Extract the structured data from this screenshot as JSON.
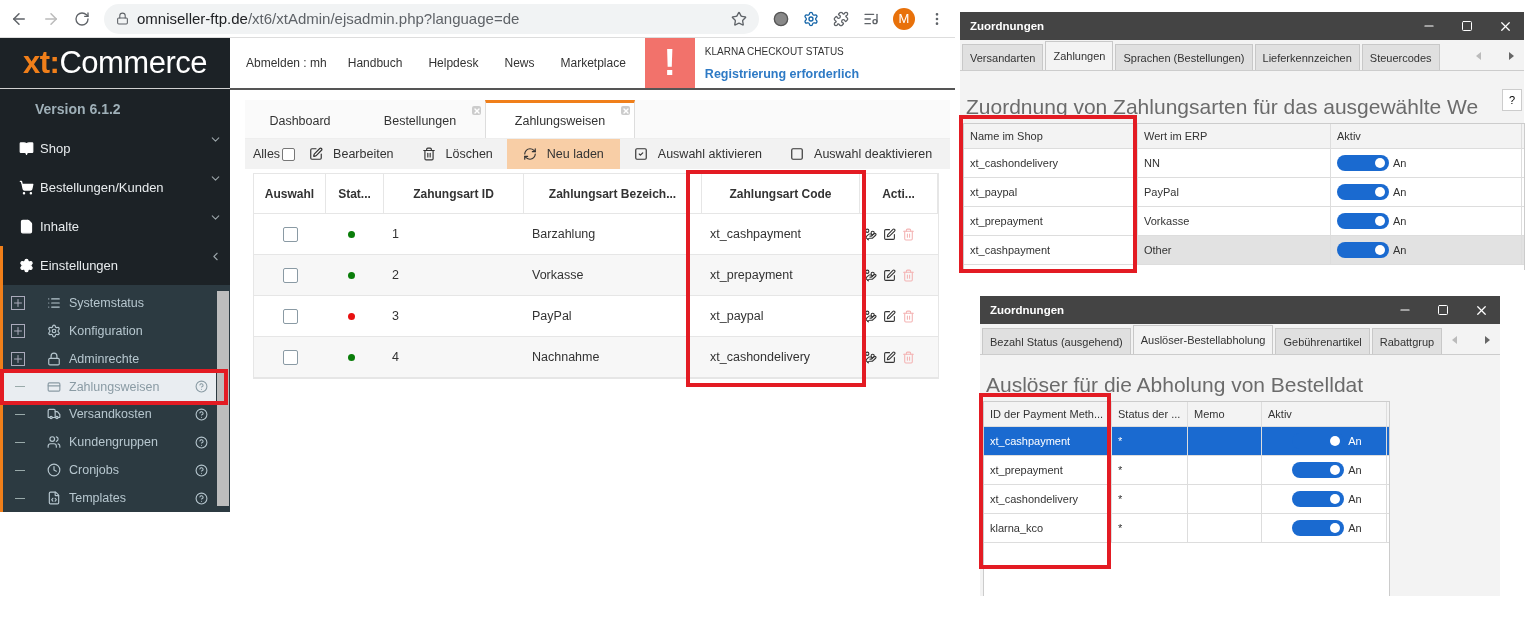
{
  "browser": {
    "url_host": "omniseller-ftp.de",
    "url_path": "/xt6/xtAdmin/ejsadmin.php?language=de",
    "avatar": "M"
  },
  "logo": {
    "prefix": "xt:",
    "name": "Commerce"
  },
  "version": "Version 6.1.2",
  "nav": [
    {
      "kind": "book",
      "label": "Shop",
      "expanded": false
    },
    {
      "kind": "cart",
      "label": "Bestellungen/Kunden",
      "expanded": false
    },
    {
      "kind": "file",
      "label": "Inhalte",
      "expanded": false
    },
    {
      "kind": "gear",
      "label": "Einstellungen",
      "expanded": true
    }
  ],
  "subnav": [
    {
      "kind": "list",
      "label": "Systemstatus",
      "expandable": true,
      "help": false,
      "selected": false,
      "annotated": false
    },
    {
      "kind": "gear",
      "label": "Konfiguration",
      "expandable": true,
      "help": false,
      "selected": false,
      "annotated": false
    },
    {
      "kind": "lock",
      "label": "Adminrechte",
      "expandable": true,
      "help": false,
      "selected": false,
      "annotated": false
    },
    {
      "kind": "card",
      "label": "Zahlungsweisen",
      "expandable": false,
      "help": true,
      "selected": true,
      "annotated": true
    },
    {
      "kind": "truck",
      "label": "Versandkosten",
      "expandable": false,
      "help": true,
      "selected": false,
      "annotated": false
    },
    {
      "kind": "users",
      "label": "Kundengruppen",
      "expandable": false,
      "help": true,
      "selected": false,
      "annotated": false
    },
    {
      "kind": "clock",
      "label": "Cronjobs",
      "expandable": false,
      "help": true,
      "selected": false,
      "annotated": false
    },
    {
      "kind": "template",
      "label": "Templates",
      "expandable": false,
      "help": true,
      "selected": false,
      "annotated": false
    }
  ],
  "topbar": {
    "links": [
      "Abmelden : mh",
      "Handbuch",
      "Helpdesk",
      "News",
      "Marketplace"
    ],
    "alert": {
      "icon": "!",
      "title": "KLARNA CHECKOUT STATUS",
      "message": "Registrierung erforderlich"
    }
  },
  "tabs": [
    {
      "label": "Dashboard",
      "selected": false,
      "closable": false
    },
    {
      "label": "Bestellungen",
      "selected": false,
      "closable": true
    },
    {
      "label": "Zahlungsweisen",
      "selected": true,
      "closable": true
    }
  ],
  "toolbar": {
    "select_all": "Alles",
    "select_all_checked": false,
    "buttons": [
      {
        "kind": "edit",
        "label": "Bearbeiten",
        "highlighted": false
      },
      {
        "kind": "delete",
        "label": "Löschen",
        "highlighted": false
      },
      {
        "kind": "reload",
        "label": "Neu laden",
        "highlighted": true
      },
      {
        "kind": "checked",
        "label": "Auswahl aktivieren",
        "highlighted": false
      },
      {
        "kind": "unchecked",
        "label": "Auswahl deaktivieren",
        "highlighted": false
      }
    ]
  },
  "table": {
    "columns": [
      {
        "label": "Auswahl",
        "annotated": false
      },
      {
        "label": "Stat...",
        "annotated": false
      },
      {
        "label": "Zahungsart ID",
        "annotated": false
      },
      {
        "label": "Zahlungsart Bezeich...",
        "annotated": false
      },
      {
        "label": "Zahlungsart Code",
        "annotated": true
      },
      {
        "label": "Acti...",
        "annotated": false
      }
    ],
    "rows": [
      {
        "checked": false,
        "color": "#0a7d0a",
        "id": "1",
        "name": "Barzahlung",
        "code": "xt_cashpayment"
      },
      {
        "checked": false,
        "color": "#0a7d0a",
        "id": "2",
        "name": "Vorkasse",
        "code": "xt_prepayment"
      },
      {
        "checked": false,
        "color": "#e81010",
        "id": "3",
        "name": "PayPal",
        "code": "xt_paypal"
      },
      {
        "checked": false,
        "color": "#0a7d0a",
        "id": "4",
        "name": "Nachnahme",
        "code": "xt_cashondelivery"
      }
    ]
  },
  "windows": [
    {
      "title": "Zuordnungen",
      "focused": false,
      "help": "?",
      "tabs": [
        {
          "label": "Versandarten",
          "selected": false
        },
        {
          "label": "Zahlungen",
          "selected": true
        },
        {
          "label": "Sprachen (Bestellungen)",
          "selected": false
        },
        {
          "label": "Lieferkennzeichen",
          "selected": false
        },
        {
          "label": "Steuercodes",
          "selected": false
        }
      ],
      "heading": "Zuordnung von Zahlungsarten für das ausgewählte We",
      "columns": [
        {
          "label": "Name im Shop",
          "annotated": true
        },
        {
          "label": "Wert im ERP",
          "annotated": false
        },
        {
          "label": "Aktiv",
          "annotated": false
        }
      ],
      "rows": [
        {
          "cells": [
            "xt_cashondelivery",
            "NN"
          ],
          "on": true,
          "toggle_label": "An",
          "selected": false
        },
        {
          "cells": [
            "xt_paypal",
            "PayPal"
          ],
          "on": true,
          "toggle_label": "An",
          "selected": false
        },
        {
          "cells": [
            "xt_prepayment",
            "Vorkasse"
          ],
          "on": true,
          "toggle_label": "An",
          "selected": false
        },
        {
          "cells": [
            "xt_cashpayment",
            "Other"
          ],
          "on": true,
          "toggle_label": "An",
          "selected": true
        }
      ]
    },
    {
      "title": "Zuordnungen",
      "focused": true,
      "tabs": [
        {
          "label": "Bezahl Status (ausgehend)",
          "selected": false
        },
        {
          "label": "Auslöser-Bestellabholung",
          "selected": true
        },
        {
          "label": "Gebührenartikel",
          "selected": false
        },
        {
          "label": "Rabattgrup",
          "selected": false
        }
      ],
      "heading": "Auslöser für die Abholung von Bestelldat",
      "columns": [
        {
          "label": "ID der Payment Meth...",
          "annotated": true
        },
        {
          "label": "Status der ...",
          "annotated": false
        },
        {
          "label": "Memo",
          "annotated": false
        },
        {
          "label": "Aktiv",
          "annotated": false
        }
      ],
      "rows": [
        {
          "cells": [
            "xt_cashpayment",
            "*",
            ""
          ],
          "on": true,
          "toggle_label": "An",
          "selected": true
        },
        {
          "cells": [
            "xt_prepayment",
            "*",
            ""
          ],
          "on": true,
          "toggle_label": "An",
          "selected": false
        },
        {
          "cells": [
            "xt_cashondelivery",
            "*",
            ""
          ],
          "on": true,
          "toggle_label": "An",
          "selected": false
        },
        {
          "cells": [
            "klarna_kco",
            "*",
            ""
          ],
          "on": true,
          "toggle_label": "An",
          "selected": false
        }
      ]
    }
  ]
}
